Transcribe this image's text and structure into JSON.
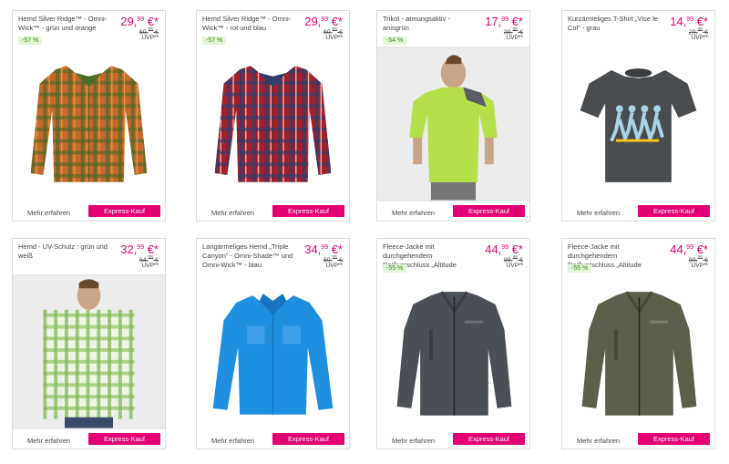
{
  "products": [
    {
      "title": "Hemd Silver Ridge™ - Omni-Wick™ - grün und orange",
      "price_main": "29,",
      "price_cents": "99",
      "price_suffix": " €*",
      "old_main": "69,",
      "old_cents": "95",
      "old_suffix": " €",
      "uvp": "UVP**",
      "discount": "-57 %",
      "image": "plaid-shirt-green-orange",
      "colors": {
        "base": "#c46a2c",
        "line": "#4f6b2a",
        "accent": "#e9a04a"
      },
      "more_label": "Mehr erfahren",
      "buy_label": "Express-Kauf"
    },
    {
      "title": "Hemd Silver Ridge™ - Omni-Wick™ - rot und blau",
      "price_main": "29,",
      "price_cents": "99",
      "price_suffix": " €*",
      "old_main": "69,",
      "old_cents": "95",
      "old_suffix": " €",
      "uvp": "UVP**",
      "discount": "-57 %",
      "image": "plaid-shirt-red-blue",
      "colors": {
        "base": "#a3202b",
        "line": "#2f3e6e",
        "accent": "#e8d7d2"
      },
      "more_label": "Mehr erfahren",
      "buy_label": "Express-Kauf"
    },
    {
      "title": "Trikot - atmungsaktiv - anisgrün",
      "price_main": "17,",
      "price_cents": "99",
      "price_suffix": " €*",
      "old_main": "39,",
      "old_cents": "95",
      "old_suffix": " €",
      "uvp": "UVP**",
      "discount": "-54 %",
      "image": "model-green-tshirt",
      "colors": {
        "base": "#b6e04a",
        "line": "#585e62",
        "accent": "#c9a487"
      },
      "more_label": "Mehr erfahren",
      "buy_label": "Express-Kauf"
    },
    {
      "title": "Kurzärmeliges T-Shirt „Vise le Col“ - grau",
      "price_main": "14,",
      "price_cents": "99",
      "price_suffix": " €*",
      "old_main": "29,",
      "old_cents": "95",
      "old_suffix": " €",
      "uvp": "UVP**",
      "discount": "",
      "image": "grey-tshirt-print",
      "colors": {
        "base": "#4a4d50",
        "line": "#a8d4e6",
        "accent": "#f2c418"
      },
      "more_label": "Mehr erfahren",
      "buy_label": "Express-Kauf"
    },
    {
      "title": "Hemd - UV-Schutz : grün und weiß",
      "price_main": "32,",
      "price_cents": "99",
      "price_suffix": " €*",
      "old_main": "64,",
      "old_cents": "95",
      "old_suffix": " €",
      "uvp": "UVP**",
      "discount": "",
      "image": "model-plaid-green",
      "colors": {
        "base": "#eef4e6",
        "line": "#7cb84a",
        "accent": "#c9a487"
      },
      "more_label": "Mehr erfahren",
      "buy_label": "Express-Kauf"
    },
    {
      "title": "Langärmeliges Hemd „Triple Canyon“ - Omni-Shade™ und Omni-Wick™ - blau",
      "price_main": "34,",
      "price_cents": "99",
      "price_suffix": " €*",
      "old_main": "69,",
      "old_cents": "95",
      "old_suffix": " €",
      "uvp": "UVP**",
      "discount": "",
      "image": "blue-shirt",
      "colors": {
        "base": "#1f8fe0",
        "line": "#1673bd",
        "accent": "#5cb2ee"
      },
      "more_label": "Mehr erfahren",
      "buy_label": "Express-Kauf"
    },
    {
      "title": "Fleece-Jacke mit durchgehendem Reißverschluss „Altitude Aspect™“ - Omni-",
      "price_main": "44,",
      "price_cents": "99",
      "price_suffix": " €*",
      "old_main": "99,",
      "old_cents": "95",
      "old_suffix": " €",
      "uvp": "UVP**",
      "discount": "-55 %",
      "image": "fleece-jacket-grey",
      "colors": {
        "base": "#4b5056",
        "line": "#3a3e43",
        "accent": "#6b7077"
      },
      "more_label": "Mehr erfahren",
      "buy_label": "Express-Kauf"
    },
    {
      "title": "Fleece-Jacke mit durchgehendem Reißverschluss „Altitude Aspect™“ - Omni-",
      "price_main": "44,",
      "price_cents": "99",
      "price_suffix": " €*",
      "old_main": "99,",
      "old_cents": "95",
      "old_suffix": " €",
      "uvp": "UVP**",
      "discount": "-55 %",
      "image": "fleece-jacket-olive",
      "colors": {
        "base": "#5d5f4c",
        "line": "#474a3a",
        "accent": "#7a7c66"
      },
      "more_label": "Mehr erfahren",
      "buy_label": "Express-Kauf"
    }
  ]
}
